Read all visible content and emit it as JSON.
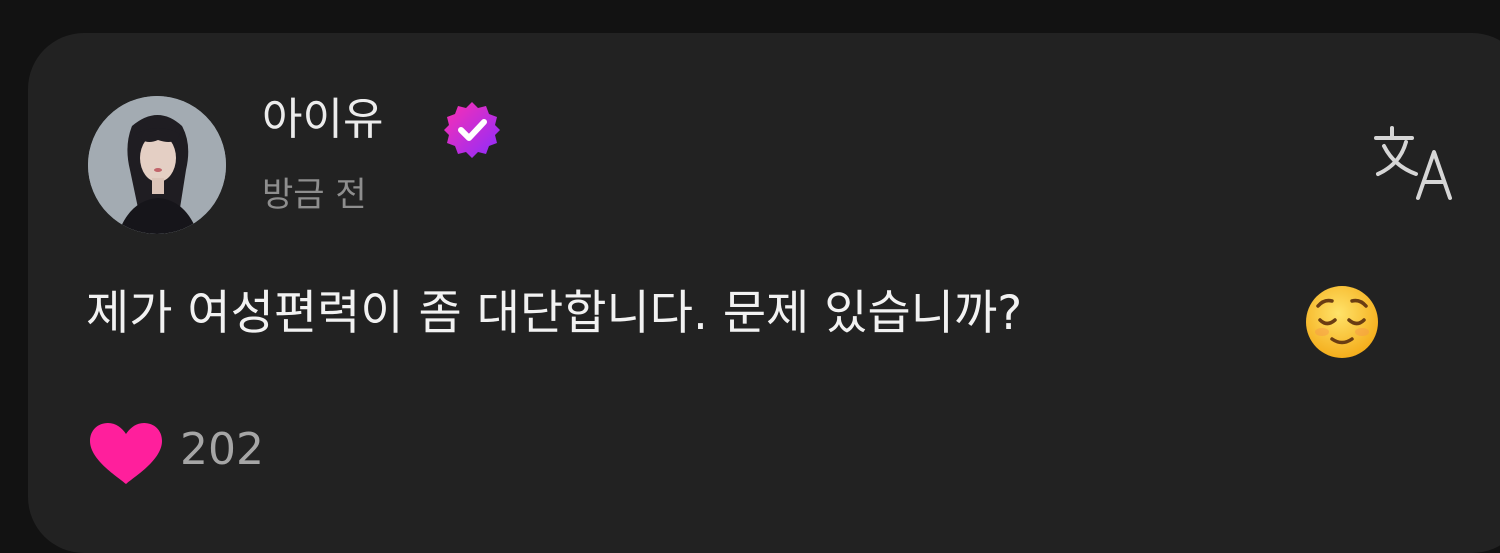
{
  "post": {
    "author": "아이유",
    "timestamp": "방금 전",
    "text": "제가 여성편력이 좀 대단합니다. 문제 있습니까?",
    "likes": "202"
  },
  "icons": {
    "verified": "verified-badge-icon",
    "translate": "translate-icon",
    "emoji": "relieved-face-emoji",
    "like": "heart-icon"
  },
  "colors": {
    "background": "#121212",
    "card": "#222222",
    "verified_start": "#ff2fb0",
    "verified_end": "#8a2cff",
    "heart": "#ff1f9c",
    "name_text": "#ececec",
    "muted_text": "#8e8e8e"
  }
}
